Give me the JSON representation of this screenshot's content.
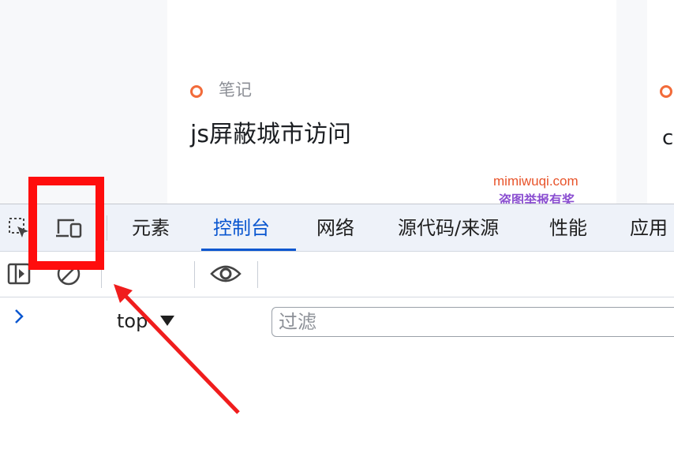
{
  "page": {
    "tag_label": "笔记",
    "title": "js屏蔽城市访问",
    "watermark_line1": "mimiwuqi.com",
    "watermark_line2": "盗图举报有奖",
    "right_card_char": "c"
  },
  "devtools": {
    "tabs": [
      {
        "label": "元素",
        "active": false
      },
      {
        "label": "控制台",
        "active": true
      },
      {
        "label": "网络",
        "active": false
      },
      {
        "label": "源代码/来源",
        "active": false
      },
      {
        "label": "性能",
        "active": false
      },
      {
        "label": "应用",
        "active": false
      }
    ],
    "icons": {
      "inspect": "inspect-element-icon",
      "device": "device-toolbar-icon",
      "sidebar": "sidebar-toggle-icon",
      "clear": "clear-console-icon",
      "eye": "live-expression-eye-icon",
      "prompt": "console-prompt-chevron-icon"
    },
    "context_select": "top",
    "filter_placeholder": "过滤"
  },
  "colors": {
    "accent": "#0b57d0",
    "tag_orange": "#f26b3a",
    "highlight_red": "#ff0d0d",
    "watermark_orange": "#e8542b",
    "watermark_purple": "#8b4fd1"
  }
}
